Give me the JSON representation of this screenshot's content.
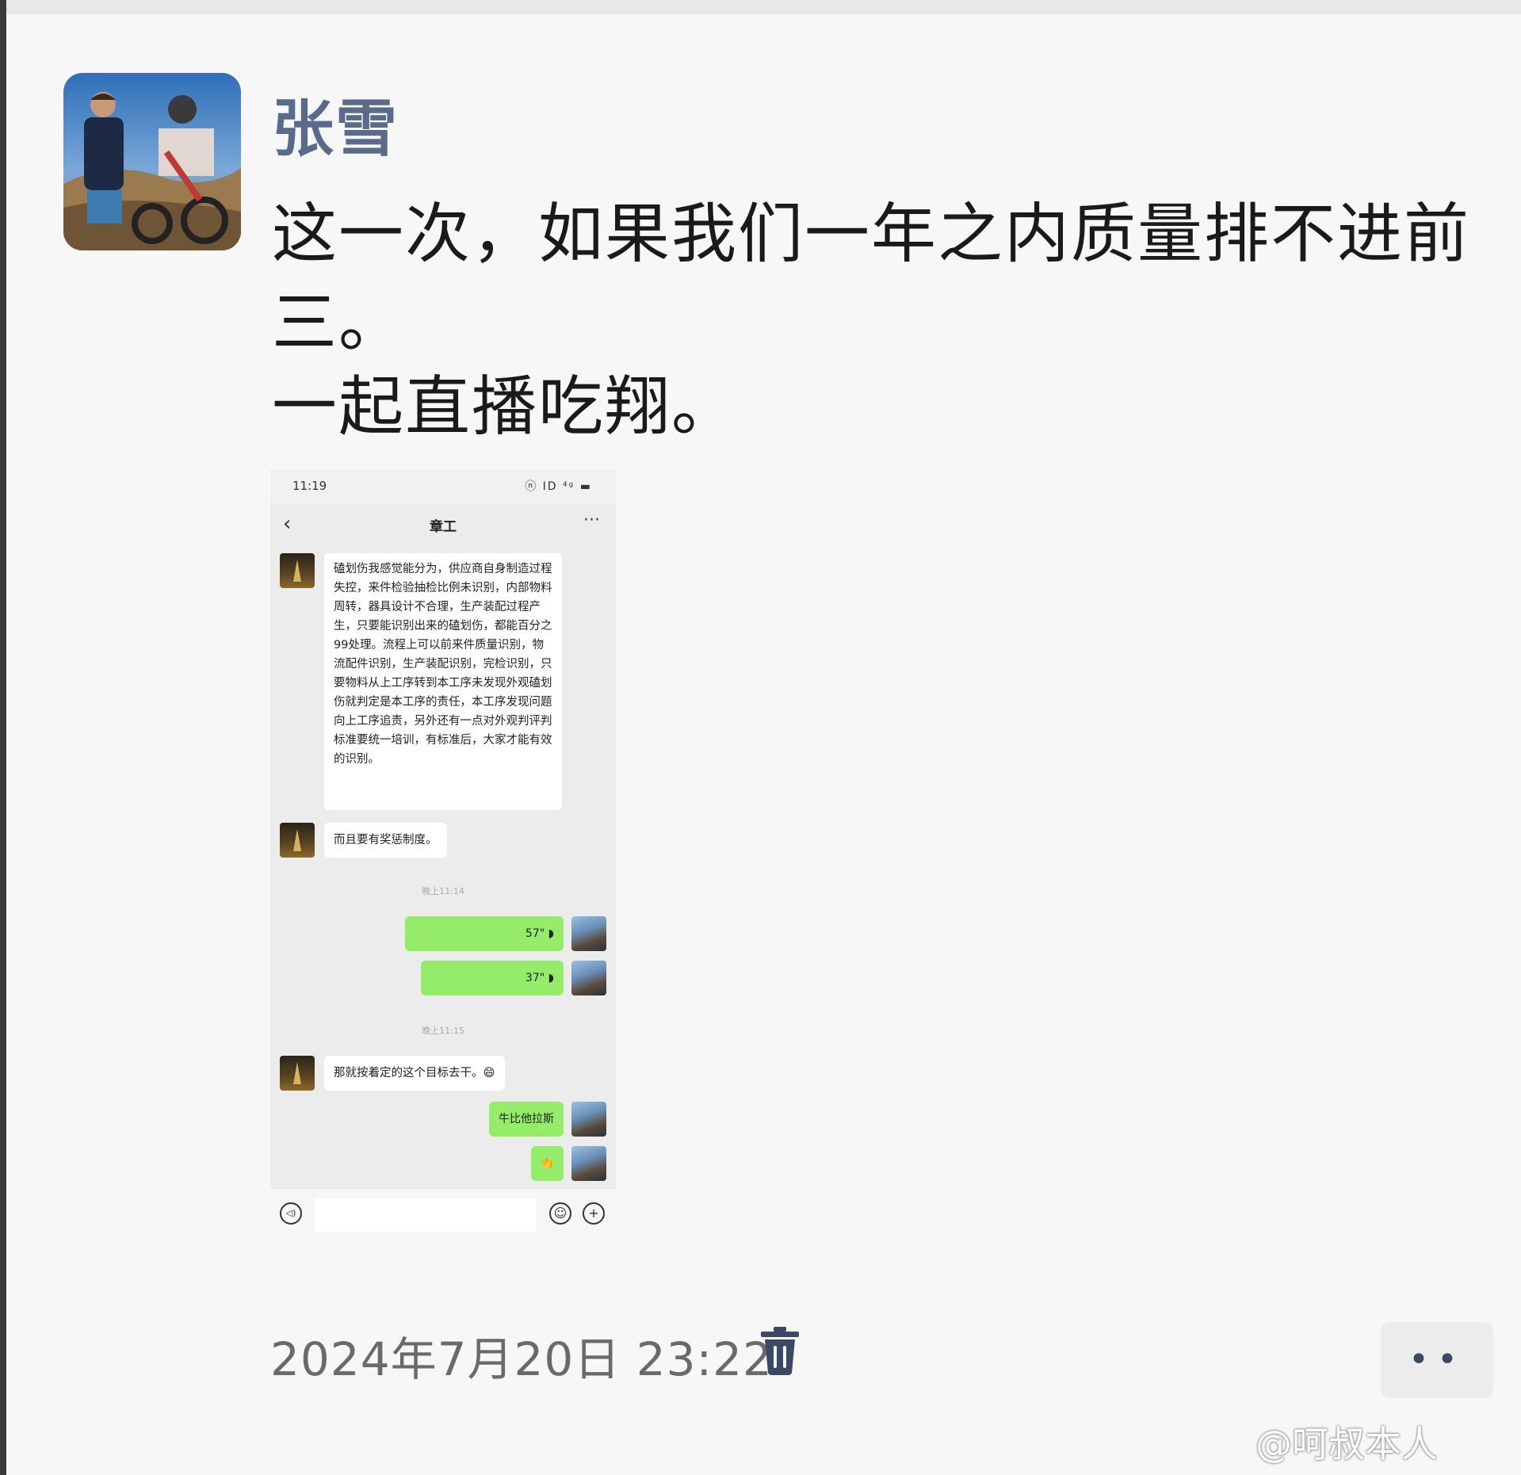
{
  "post": {
    "author": "张雪",
    "lines": [
      "这一次，如果我们一年之内质量排不进前",
      "三。",
      "一起直播吃翔。"
    ],
    "timestamp": "2024年7月20日 23:22"
  },
  "screenshot": {
    "status_time": "11:19",
    "status_icons": "ⓝ ID ⁴ᵍ ▬",
    "chat_title": "章工",
    "back_icon": "‹",
    "more_icon": "···",
    "messages": [
      {
        "from": "other",
        "text": "磕划伤我感觉能分为，供应商自身制造过程失控，来件检验抽检比例未识别，内部物料周转，器具设计不合理，生产装配过程产生，只要能识别出来的磕划伤，都能百分之99处理。流程上可以前来件质量识别，物流配件识别，生产装配识别，完检识别，只要物料从上工序转到本工序未发现外观磕划伤就判定是本工序的责任，本工序发现问题向上工序追责，另外还有一点对外观判评判标准要统一培训，有标准后，大家才能有效的识别。"
      },
      {
        "from": "other",
        "text": "而且要有奖惩制度。"
      },
      {
        "from": "time",
        "text": "晚上11:14"
      },
      {
        "from": "me",
        "text": "57\" ◗"
      },
      {
        "from": "me",
        "text": "37\" ◗"
      },
      {
        "from": "time",
        "text": "晚上11:15"
      },
      {
        "from": "other",
        "text": "那就按着定的这个目标去干。😄"
      },
      {
        "from": "me",
        "text": "牛比他拉斯"
      },
      {
        "from": "me",
        "text": "👏"
      }
    ],
    "input_icons": {
      "voice": "◁)",
      "emoji": "☺",
      "plus": "+"
    }
  },
  "more_button": "••",
  "watermark": "@呵叔本人",
  "colors": {
    "author": "#5a6a8a",
    "bubble_out": "#95ec69",
    "more_dots": "#3a4a64"
  }
}
